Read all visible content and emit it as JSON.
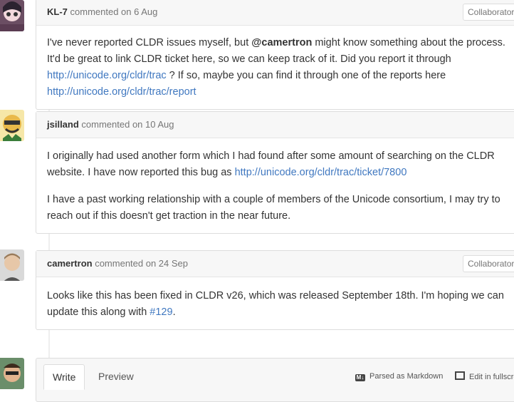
{
  "comments": [
    {
      "author": "KL-7",
      "meta": "commented on 6 Aug",
      "badge": "Collaborator",
      "body_p1_a": "I've never reported CLDR issues myself, but ",
      "mention": "@camertron",
      "body_p1_b": " might know something about the process. It'd be great to link CLDR ticket here, so we can keep track of it. Did you report it through ",
      "link1": "http://unicode.org/cldr/trac",
      "body_p1_c": " ? If so, maybe you can find it through one of the reports here ",
      "link2": "http://unicode.org/cldr/trac/report"
    },
    {
      "author": "jsilland",
      "meta": "commented on 10 Aug",
      "body_p1_a": "I originally had used another form which I had found after some amount of searching on the CLDR website. I have now reported this bug as ",
      "link1": "http://unicode.org/cldr/trac/ticket/7800",
      "body_p2": "I have a past working relationship with a couple of members of the Unicode consortium, I may try to reach out if this doesn't get traction in the near future."
    },
    {
      "author": "camertron",
      "meta": "commented on 24 Sep",
      "badge": "Collaborator",
      "body_p1_a": "Looks like this has been fixed in CLDR v26, which was released September 18th. I'm hoping we can update this along with ",
      "link1": "#129",
      "body_p1_b": "."
    }
  ],
  "composer": {
    "write_tab": "Write",
    "preview_tab": "Preview",
    "markdown_label": "Parsed as Markdown",
    "fullscreen_label": "Edit in fullscreen"
  },
  "icons": {
    "markdown": "markdown-icon",
    "fullscreen": "fullscreen-icon"
  },
  "colors": {
    "link": "#4078c0",
    "header_bg": "#f7f7f7",
    "border": "#dddddd"
  }
}
